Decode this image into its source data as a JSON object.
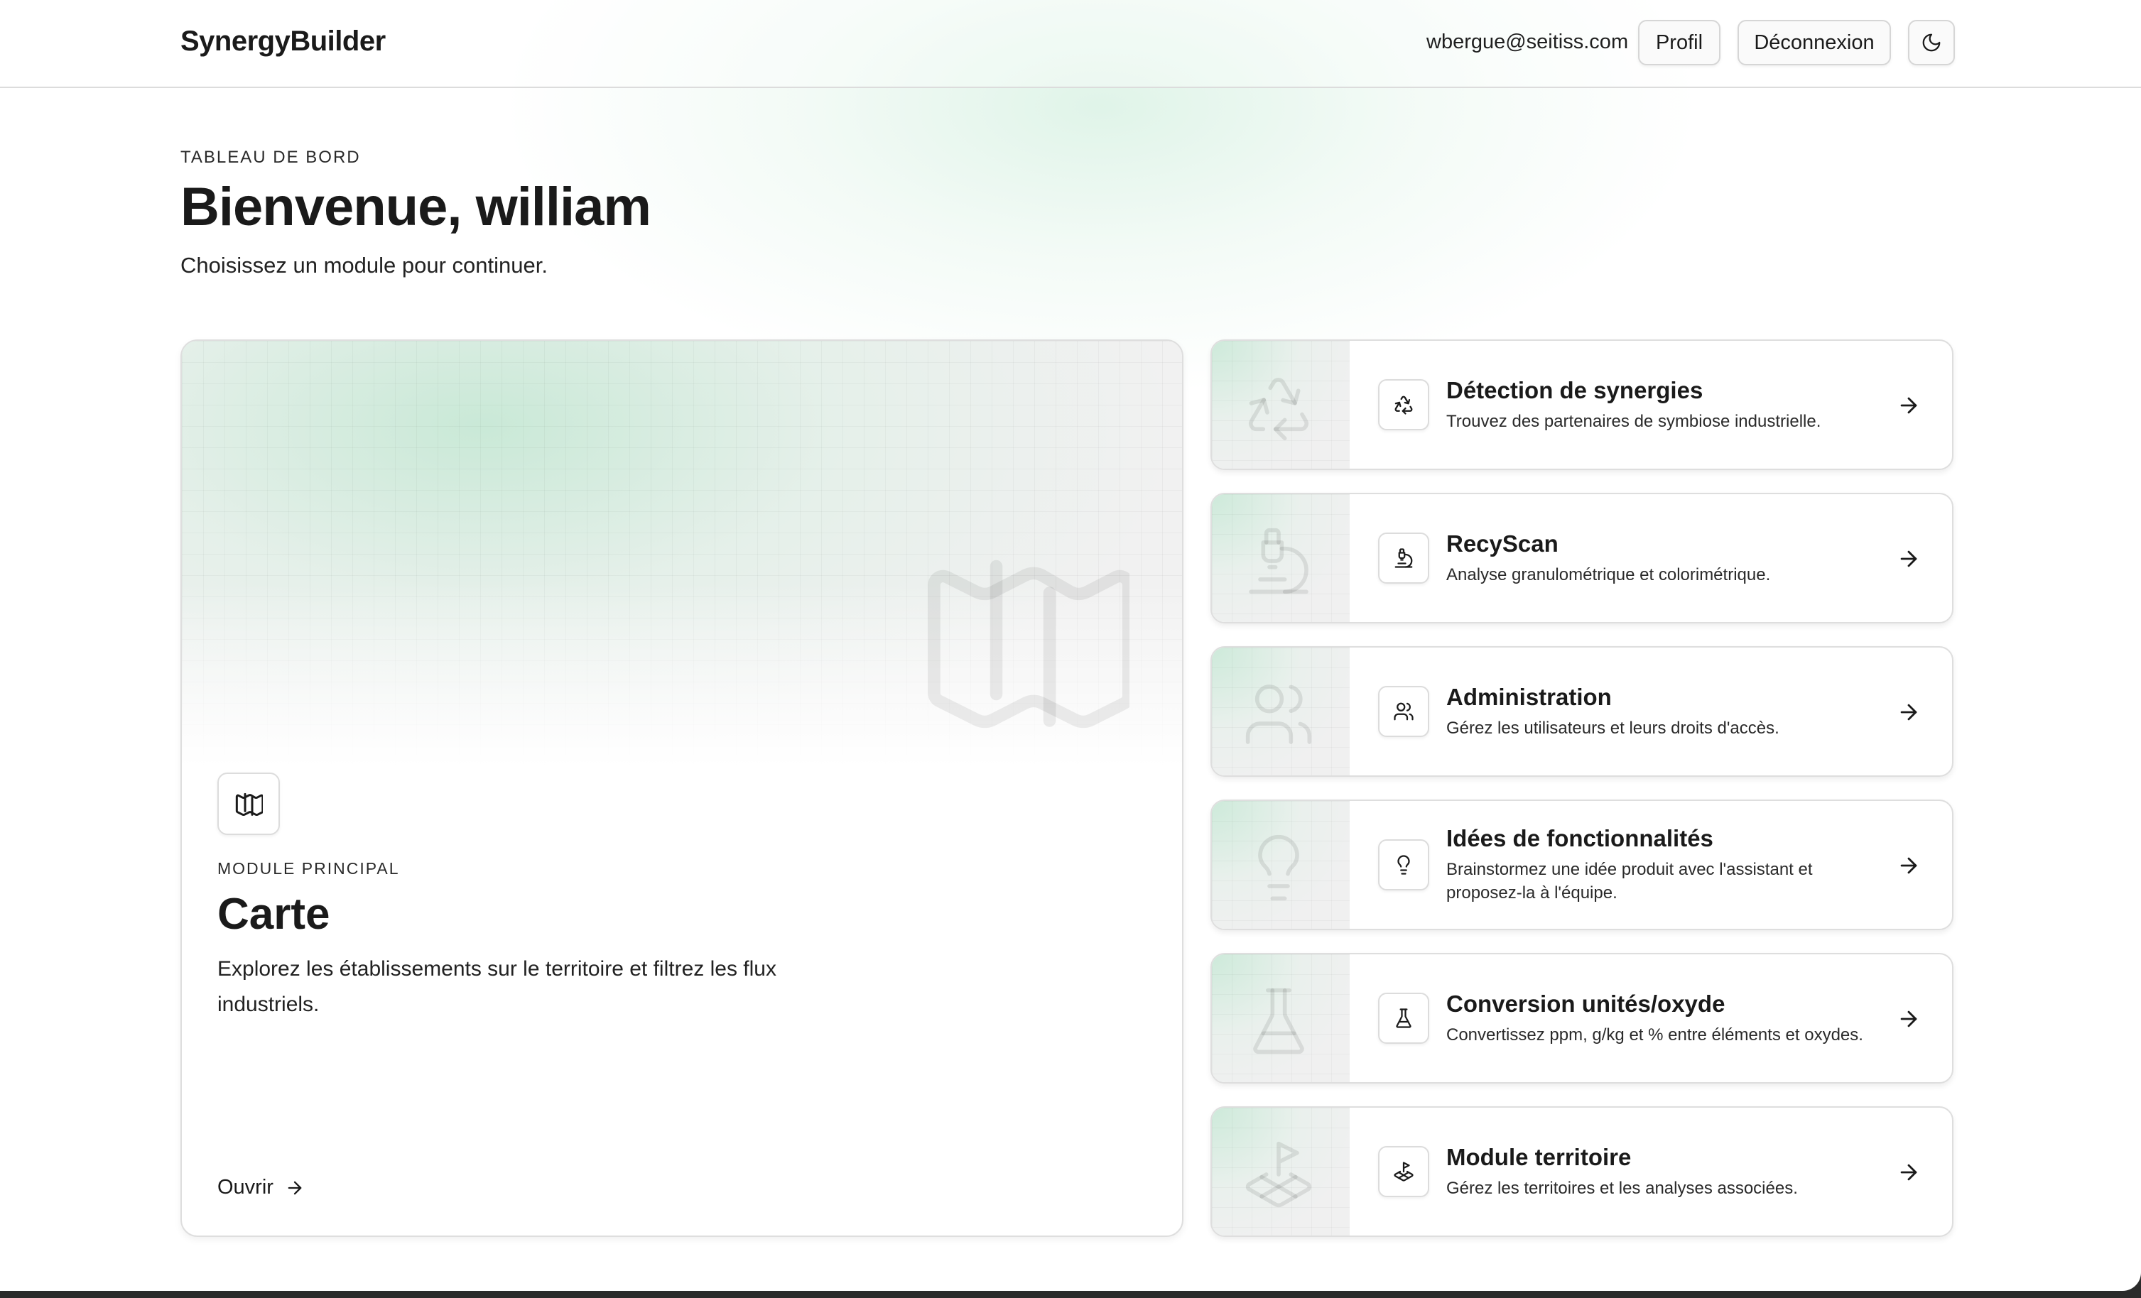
{
  "header": {
    "brand": "SynergyBuilder",
    "email": "wbergue@seitiss.com",
    "profile_label": "Profil",
    "logout_label": "Déconnexion",
    "theme_icon": "moon-icon"
  },
  "page": {
    "eyebrow": "TABLEAU DE BORD",
    "title": "Bienvenue, william",
    "subtitle": "Choisissez un module pour continuer."
  },
  "main_module": {
    "icon": "map-icon",
    "eyebrow": "MODULE PRINCIPAL",
    "title": "Carte",
    "description": "Explorez les établissements sur le territoire et filtrez les flux industriels.",
    "open_label": "Ouvrir"
  },
  "modules": [
    {
      "title": "Détection de synergies",
      "description": "Trouvez des partenaires de symbiose industrielle.",
      "icon": "recycle-icon"
    },
    {
      "title": "RecyScan",
      "description": "Analyse granulométrique et colorimétrique.",
      "icon": "microscope-icon"
    },
    {
      "title": "Administration",
      "description": "Gérez les utilisateurs et leurs droits d'accès.",
      "icon": "users-icon"
    },
    {
      "title": "Idées de fonctionnalités",
      "description": "Brainstormez une idée produit avec l'assistant et proposez-la à l'équipe.",
      "icon": "lightbulb-icon"
    },
    {
      "title": "Conversion unités/oxyde",
      "description": "Convertissez ppm, g/kg et % entre éléments et oxydes.",
      "icon": "flask-icon"
    },
    {
      "title": "Module territoire",
      "description": "Gérez les territoires et les analyses associées.",
      "icon": "land-plot-icon"
    }
  ],
  "colors": {
    "accent_glow": "#c6ebd6",
    "text": "#1a1a1a",
    "border": "#dedede"
  }
}
